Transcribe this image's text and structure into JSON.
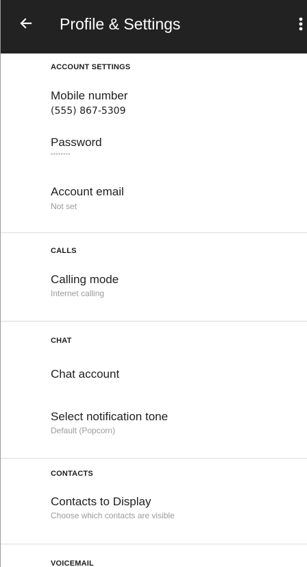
{
  "app_bar": {
    "title": "Profile & Settings",
    "back_icon": "arrow-left-icon",
    "menu_icon": "more-vertical-icon",
    "background": "#222222"
  },
  "sections": {
    "account": {
      "header": "ACCOUNT SETTINGS",
      "mobile_number": {
        "label": "Mobile number",
        "value": "(555) 867-5309"
      },
      "password": {
        "label": "Password",
        "value": "********"
      },
      "account_email": {
        "label": "Account email",
        "value": "Not set"
      }
    },
    "calls": {
      "header": "CALLS",
      "calling_mode": {
        "label": "Calling mode",
        "value": "Internet calling"
      }
    },
    "chat": {
      "header": "CHAT",
      "chat_account": {
        "label": "Chat account"
      },
      "notification_tone": {
        "label": "Select notification tone",
        "value": "Default (Popcorn)"
      }
    },
    "contacts": {
      "header": "CONTACTS",
      "contacts_display": {
        "label": "Contacts to Display",
        "value": "Choose which contacts are visible"
      }
    },
    "voicemail": {
      "header": "VOICEMAIL"
    }
  }
}
